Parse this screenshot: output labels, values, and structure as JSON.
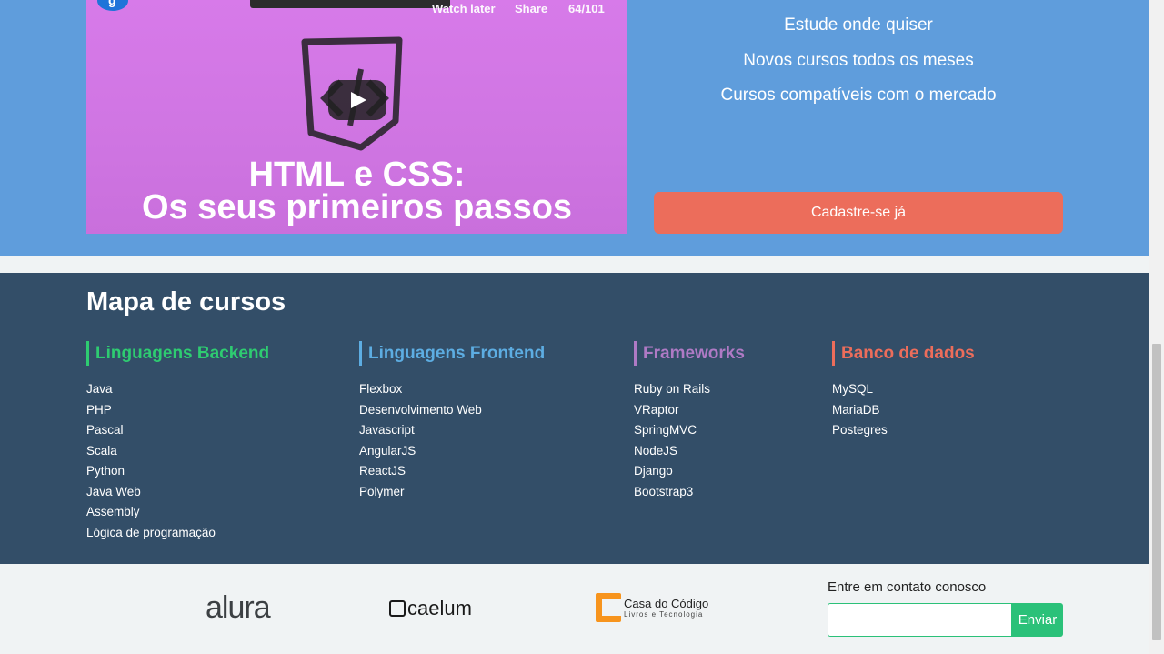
{
  "video": {
    "watch_later": "Watch later",
    "share": "Share",
    "counter": "64/101",
    "title_line1": "HTML e CSS:",
    "title_line2": "Os seus primeiros passos"
  },
  "benefits": [
    "Estude onde quiser",
    "Novos cursos todos os meses",
    "Cursos compatíveis com o mercado"
  ],
  "cta_label": "Cadastre-se já",
  "course_map": {
    "title": "Mapa de cursos",
    "columns": [
      {
        "heading": "Linguagens Backend",
        "color": "#2ecc71",
        "items": [
          "Java",
          "PHP",
          "Pascal",
          "Scala",
          "Python",
          "Java Web",
          "Assembly",
          "Lógica de programação"
        ]
      },
      {
        "heading": "Linguagens Frontend",
        "color": "#5dade2",
        "items": [
          "Flexbox",
          "Desenvolvimento Web",
          "Javascript",
          "AngularJS",
          "ReactJS",
          "Polymer"
        ]
      },
      {
        "heading": "Frameworks",
        "color": "#af7ac5",
        "items": [
          "Ruby on Rails",
          "VRaptor",
          "SpringMVC",
          "NodeJS",
          "Django",
          "Bootstrap3"
        ]
      },
      {
        "heading": "Banco de dados",
        "color": "#ec6d5b",
        "items": [
          "MySQL",
          "MariaDB",
          "Postegres"
        ]
      }
    ]
  },
  "footer": {
    "logos": {
      "alura": "alura",
      "caelum": "caelum",
      "cdc_name": "Casa do Código",
      "cdc_sub": "Livros e Tecnologia"
    },
    "contact_label": "Entre em contato conosco",
    "contact_input_value": "",
    "send_label": "Enviar"
  },
  "colors": {
    "hero_bg": "#5f9ddc",
    "map_bg": "#334e68",
    "cta": "#ec6d5b",
    "send": "#2bc179"
  }
}
